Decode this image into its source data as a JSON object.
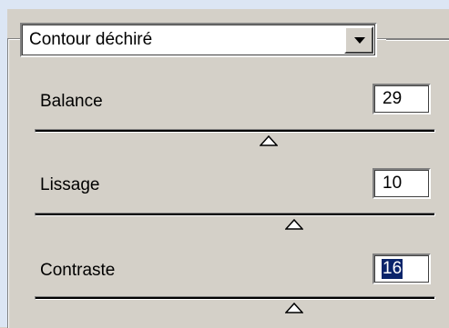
{
  "dropdown": {
    "value": "Contour déchiré"
  },
  "sliders": [
    {
      "label": "Balance",
      "value": "29",
      "level_pct": 57
    },
    {
      "label": "Lissage",
      "value": "10",
      "level_pct": 64
    },
    {
      "label": "Contraste",
      "value": "16",
      "level_pct": 65
    }
  ],
  "icons": {
    "dropdown_arrow": "chevron-down-icon",
    "slider_thumb": "triangle-up-icon"
  }
}
